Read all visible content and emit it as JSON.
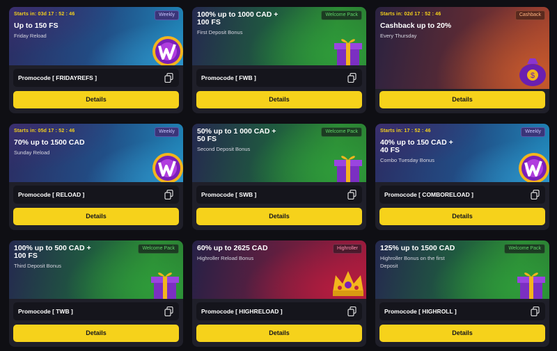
{
  "cards": [
    {
      "timer": "Starts in: 03d 17 : 52 : 46",
      "badge": "Weekly",
      "title_line1": "Up to 150 FS",
      "title_line2": "",
      "subtitle_line1": "Friday Reload",
      "subtitle_line2": "",
      "promo": "Promocode [ FRIDAYREFS ]",
      "details": "Details"
    },
    {
      "timer": "",
      "badge": "Welcome Pack",
      "title_line1": "100% up to 1000 CAD +",
      "title_line2": "100 FS",
      "subtitle_line1": "First Deposit Bonus",
      "subtitle_line2": "",
      "promo": "Promocode [ FWB ]",
      "details": "Details"
    },
    {
      "timer": "Starts in: 02d 17 : 52 : 46",
      "badge": "Cashback",
      "title_line1": "Cashback up to 20%",
      "title_line2": "",
      "subtitle_line1": "Every Thursday",
      "subtitle_line2": "",
      "promo": "",
      "details": "Details"
    },
    {
      "timer": "Starts in: 05d 17 : 52 : 46",
      "badge": "Weekly",
      "title_line1": "70% up to 1500 CAD",
      "title_line2": "",
      "subtitle_line1": "Sunday Reload",
      "subtitle_line2": "",
      "promo": "Promocode [ RELOAD ]",
      "details": "Details"
    },
    {
      "timer": "",
      "badge": "Welcome Pack",
      "title_line1": "50% up to 1 000 CAD +",
      "title_line2": "50 FS",
      "subtitle_line1": "Second Deposit Bonus",
      "subtitle_line2": "",
      "promo": "Promocode [ SWB ]",
      "details": "Details"
    },
    {
      "timer": "Starts in: 17 : 52 : 46",
      "badge": "Weekly",
      "title_line1": "40% up to 150 CAD +",
      "title_line2": "40 FS",
      "subtitle_line1": "Combo Tuesday Bonus",
      "subtitle_line2": "",
      "promo": "Promocode [ COMBORELOAD ]",
      "details": "Details"
    },
    {
      "timer": "",
      "badge": "Welcome Pack",
      "title_line1": "100% up to 500 CAD +",
      "title_line2": "100 FS",
      "subtitle_line1": "Third Deposit Bonus",
      "subtitle_line2": "",
      "promo": "Promocode [ TWB ]",
      "details": "Details"
    },
    {
      "timer": "",
      "badge": "Highroller",
      "title_line1": "60% up to 2625 CAD",
      "title_line2": "",
      "subtitle_line1": "Highroller Reload Bonus",
      "subtitle_line2": "",
      "promo": "Promocode [ HIGHRELOAD ]",
      "details": "Details"
    },
    {
      "timer": "",
      "badge": "Welcome Pack",
      "title_line1": "125% up to 1500 CAD",
      "title_line2": "",
      "subtitle_line1": "Highroller Bonus on the first",
      "subtitle_line2": "Deposit",
      "promo": "Promocode [ HIGHROLL ]",
      "details": "Details"
    }
  ],
  "icons": {
    "copy": "copy-icon",
    "wheel": "wheel-icon",
    "gift": "gift-icon",
    "money-bag": "money-bag-icon",
    "crown": "crown-icon"
  },
  "colors": {
    "accent": "#f6d21b",
    "card": "#1f1f29",
    "page": "#0f0f14"
  }
}
